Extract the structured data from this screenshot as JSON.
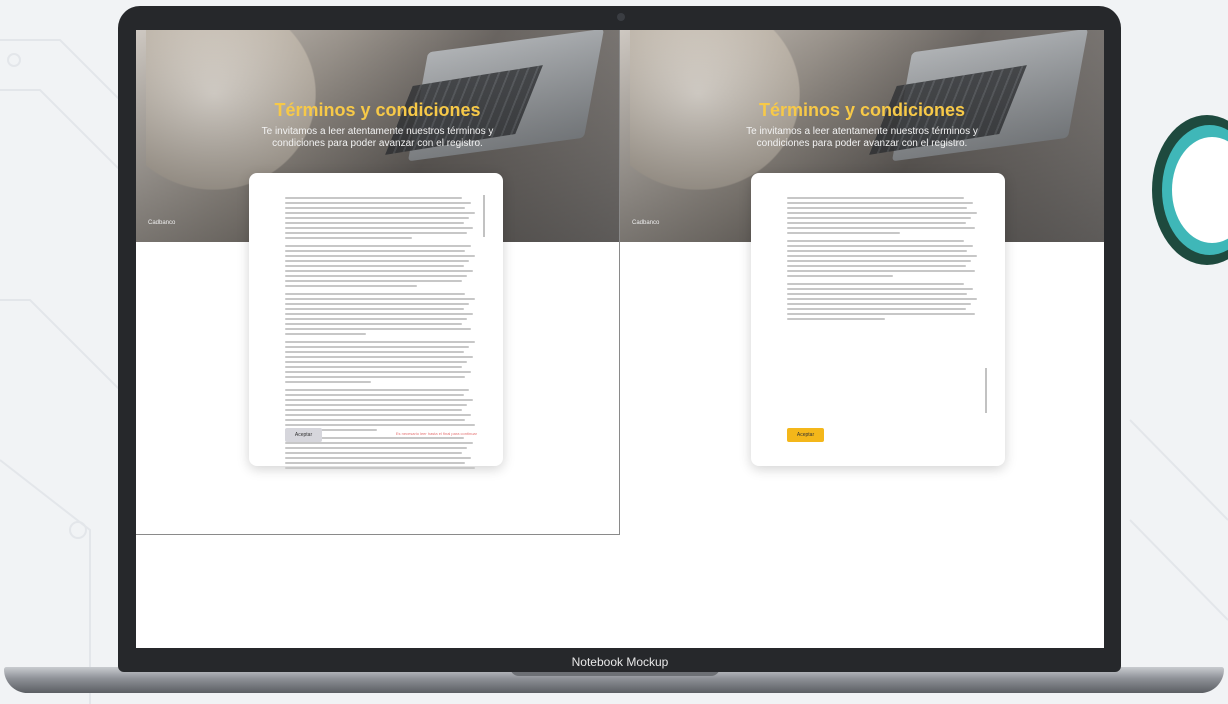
{
  "mockup_label": "Notebook Mockup",
  "panels": [
    {
      "title": "Términos y condiciones",
      "subtitle": "Te invitamos a leer atentamente nuestros términos y condiciones para poder avanzar con el registro.",
      "breadcrumb": "Cadbanco",
      "accept_label": "Aceptar",
      "accept_state": "disabled",
      "warning_text": "Es necesario leer hasta el final para continuar"
    },
    {
      "title": "Términos y condiciones",
      "subtitle": "Te invitamos a leer atentamente nuestros términos y condiciones para poder avanzar con el registro.",
      "breadcrumb": "Cadbanco",
      "accept_label": "Aceptar",
      "accept_state": "enabled"
    }
  ],
  "colors": {
    "title": "#f7c948",
    "accept_enabled": "#f4b71a",
    "accept_disabled": "#d6d6dc",
    "deco_dark": "#1e4a3e",
    "deco_teal": "#3fb7b8"
  }
}
